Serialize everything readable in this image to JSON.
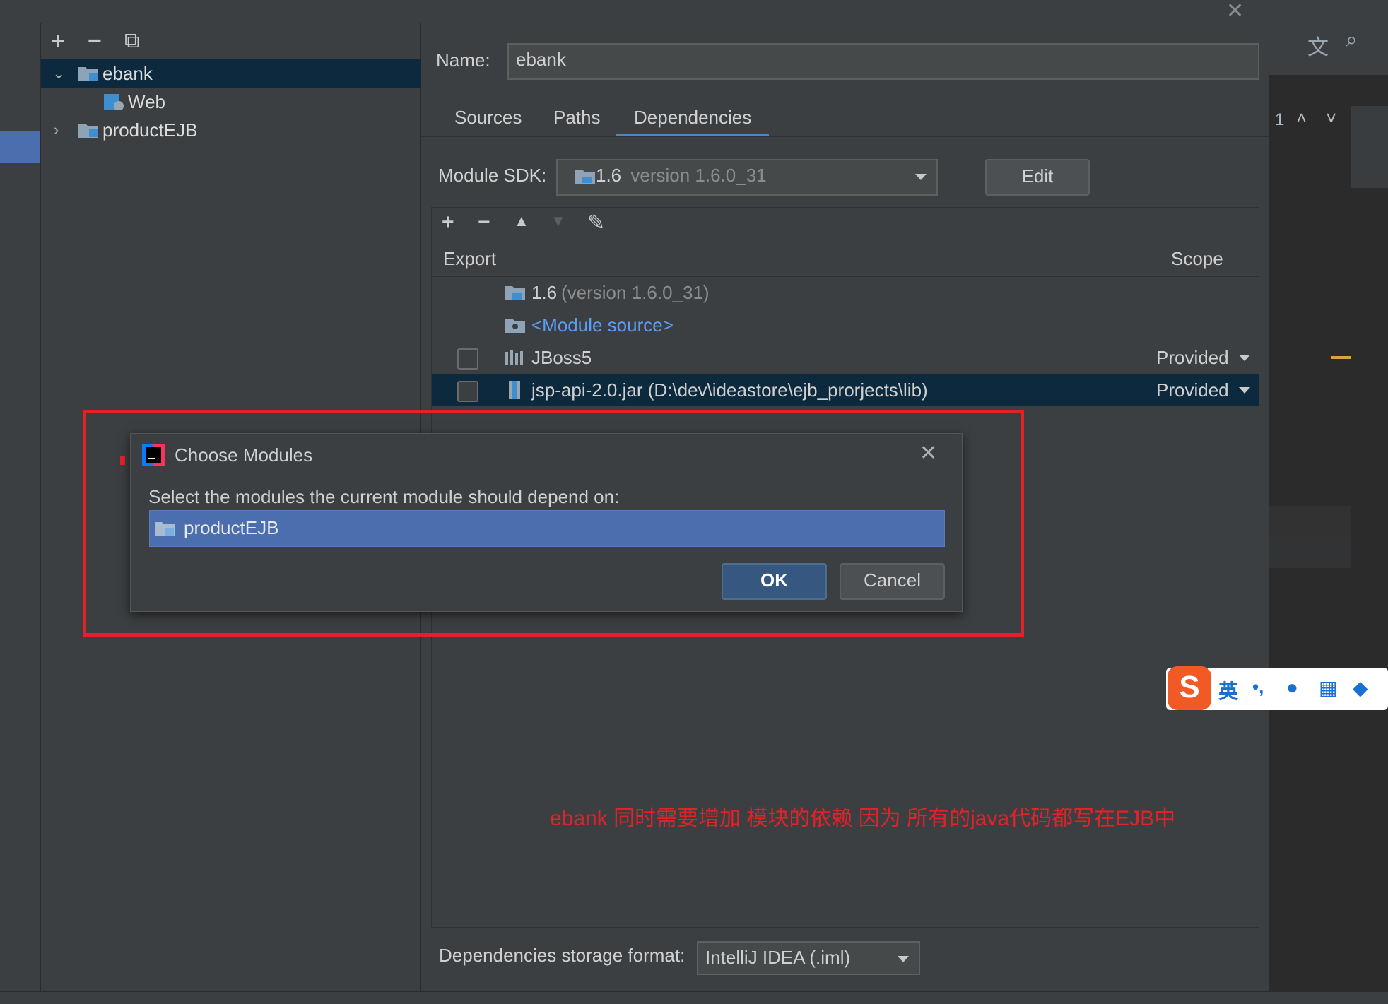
{
  "tree": {
    "toolbar": {
      "add": "+",
      "remove": "−",
      "copy": "⧉"
    },
    "items": [
      {
        "label": "ebank"
      },
      {
        "label": "Web"
      },
      {
        "label": "productEJB"
      }
    ]
  },
  "config": {
    "name_label": "Name:",
    "name_value": "ebank",
    "tabs": [
      "Sources",
      "Paths",
      "Dependencies"
    ],
    "active_tab": "Dependencies",
    "sdk_label": "Module SDK:",
    "sdk_value_main": "1.6",
    "sdk_value_version": "version 1.6.0_31",
    "edit_label": "Edit",
    "deps_toolbar": {
      "add": "+",
      "remove": "−",
      "up": "▲",
      "down": "▼",
      "edit": "✎"
    },
    "columns": {
      "export": "Export",
      "scope": "Scope"
    },
    "rows": [
      {
        "name": "1.6",
        "detail": "(version 1.6.0_31)",
        "scope": "",
        "checkbox": false
      },
      {
        "name": "<Module source>",
        "detail": "",
        "scope": "",
        "checkbox": false
      },
      {
        "name": "JBoss5",
        "detail": "",
        "scope": "Provided",
        "checkbox": true
      },
      {
        "name": "jsp-api-2.0.jar (D:\\dev\\ideastore\\ejb_prorjects\\lib)",
        "detail": "",
        "scope": "Provided",
        "checkbox": true
      }
    ],
    "storage_label": "Dependencies storage format:",
    "storage_value": "IntelliJ IDEA (.iml)"
  },
  "dialog": {
    "title": "Choose Modules",
    "prompt": "Select the modules the current module should depend on:",
    "modules": [
      "productEJB"
    ],
    "ok_label": "OK",
    "cancel_label": "Cancel"
  },
  "annotation": "ebank 同时需要增加  模块的依赖 因为 所有的java代码都写在EJB中",
  "editor": {
    "line_number": "1"
  },
  "ime": {
    "mode": "英",
    "punct": "•,"
  },
  "colors": {
    "annotation_red": "#e32228",
    "selection_blue": "#4b6eaf",
    "tree_selection": "#0d293e",
    "link_blue": "#589df6"
  }
}
